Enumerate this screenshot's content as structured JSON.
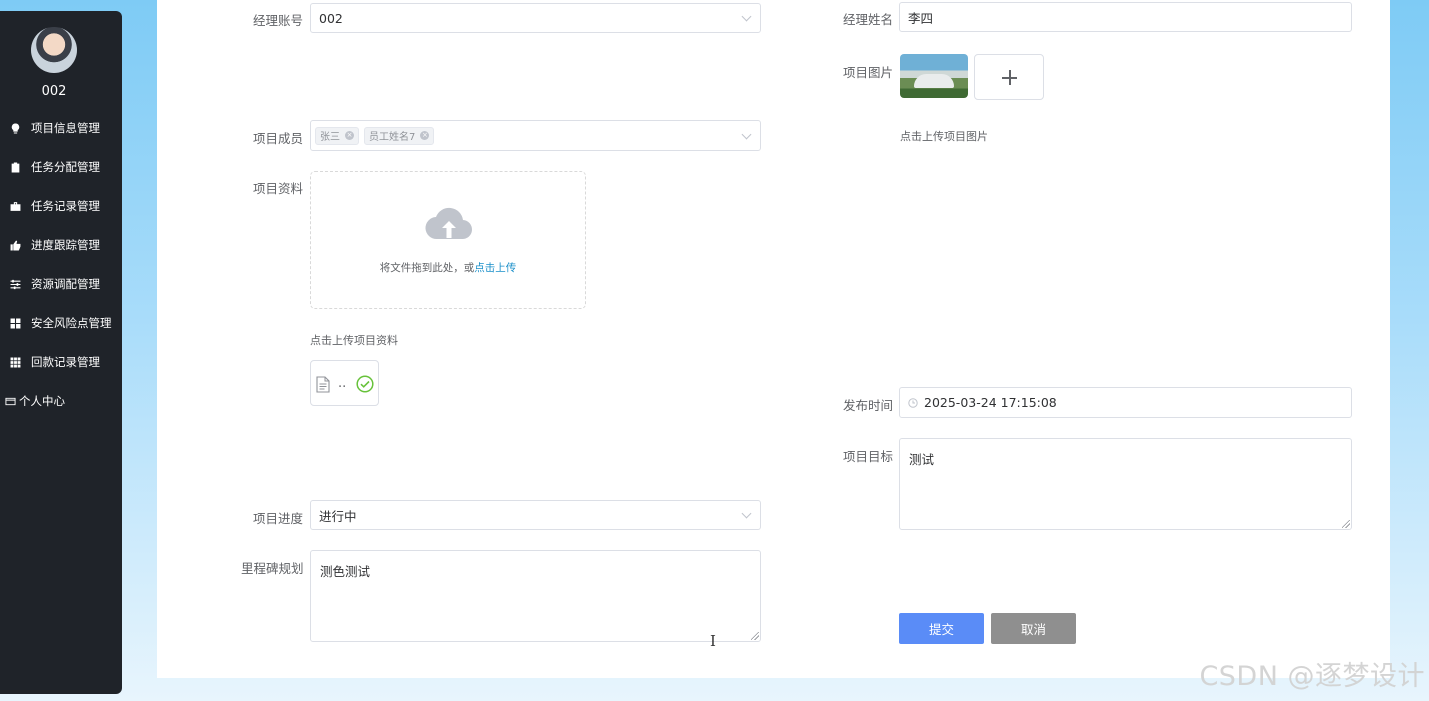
{
  "sidebar": {
    "username": "002",
    "items": [
      {
        "label": "项目信息管理",
        "icon": "lightbulb-icon"
      },
      {
        "label": "任务分配管理",
        "icon": "clipboard-icon"
      },
      {
        "label": "任务记录管理",
        "icon": "briefcase-icon"
      },
      {
        "label": "进度跟踪管理",
        "icon": "thumbs-up-icon"
      },
      {
        "label": "资源调配管理",
        "icon": "sliders-icon"
      },
      {
        "label": "安全风险点管理",
        "icon": "grid-icon"
      },
      {
        "label": "回款记录管理",
        "icon": "table-icon"
      },
      {
        "label": "个人中心",
        "icon": "id-card-icon"
      }
    ]
  },
  "form": {
    "manager_account": {
      "label": "经理账号",
      "value": "002"
    },
    "manager_name": {
      "label": "经理姓名",
      "value": "李四"
    },
    "project_image": {
      "label": "项目图片",
      "hint": "点击上传项目图片"
    },
    "project_members": {
      "label": "项目成员",
      "tags": [
        "张三",
        "员工姓名7"
      ]
    },
    "project_files": {
      "label": "项目资料",
      "drag_text": "将文件拖到此处，或",
      "drag_link": "点击上传",
      "hint": "点击上传项目资料",
      "file_name": ".."
    },
    "publish_time": {
      "label": "发布时间",
      "value": "2025-03-24 17:15:08"
    },
    "project_goal": {
      "label": "项目目标",
      "value": "测试"
    },
    "project_progress": {
      "label": "项目进度",
      "value": "进行中"
    },
    "milestone_plan": {
      "label": "里程碑规划",
      "value": "测色测试"
    },
    "submit_label": "提交",
    "cancel_label": "取消"
  },
  "watermark": "CSDN @逐梦设计",
  "colors": {
    "primary": "#5a8cf7",
    "sidebar": "#1f2329",
    "link": "#1a8fc9",
    "success": "#67c23a"
  }
}
